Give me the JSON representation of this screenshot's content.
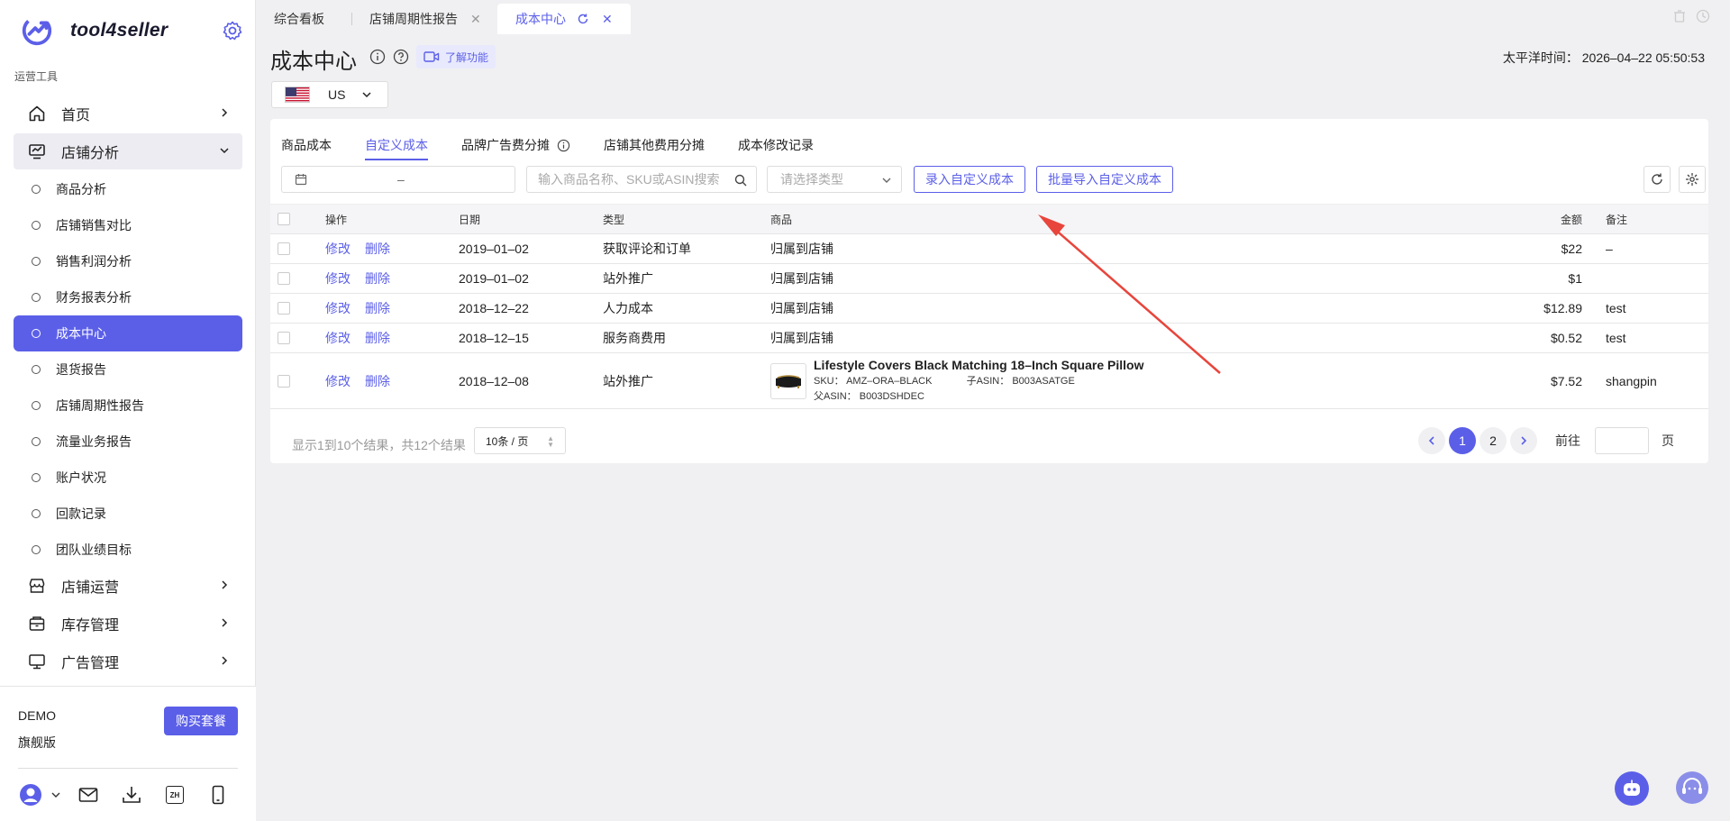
{
  "sidebar": {
    "brand": "tool4seller",
    "section_label": "运营工具",
    "top_items": [
      {
        "label": "首页",
        "icon": "home-icon"
      },
      {
        "label": "店铺分析",
        "icon": "analytics-icon"
      }
    ],
    "sub_items": [
      {
        "label": "商品分析"
      },
      {
        "label": "店铺销售对比"
      },
      {
        "label": "销售利润分析"
      },
      {
        "label": "财务报表分析"
      },
      {
        "label": "成本中心",
        "active": true
      },
      {
        "label": "退货报告"
      },
      {
        "label": "店铺周期性报告"
      },
      {
        "label": "流量业务报告"
      },
      {
        "label": "账户状况"
      },
      {
        "label": "回款记录"
      },
      {
        "label": "团队业绩目标"
      }
    ],
    "bottom_items": [
      {
        "label": "店铺运营",
        "icon": "store-icon"
      },
      {
        "label": "库存管理",
        "icon": "inventory-icon"
      },
      {
        "label": "广告管理",
        "icon": "monitor-icon"
      }
    ],
    "plan_name": "DEMO",
    "plan_tier": "旗舰版",
    "buy_button": "购买套餐",
    "lang_badge": "ZH"
  },
  "tabs": [
    {
      "label": "综合看板"
    },
    {
      "label": "店铺周期性报告"
    },
    {
      "label": "成本中心",
      "active": true
    }
  ],
  "header": {
    "title": "成本中心",
    "learn_button": "了解功能",
    "timezone": "太平洋时间： 2026–04–22 05:50:53",
    "country": "US"
  },
  "subtabs": [
    {
      "label": "商品成本"
    },
    {
      "label": "自定义成本",
      "active": true
    },
    {
      "label": "品牌广告费分摊"
    },
    {
      "label": "店铺其他费用分摊"
    },
    {
      "label": "成本修改记录"
    }
  ],
  "filters": {
    "date_separator": "–",
    "search_placeholder": "输入商品名称、SKU或ASIN搜索",
    "type_placeholder": "请选择类型",
    "add_button": "录入自定义成本",
    "import_button": "批量导入自定义成本"
  },
  "table": {
    "columns": {
      "op": "操作",
      "date": "日期",
      "type": "类型",
      "product": "商品",
      "amount": "金额",
      "note": "备注"
    },
    "edit_label": "修改",
    "delete_label": "删除",
    "rows": [
      {
        "date": "2019–01–02",
        "type": "获取评论和订单",
        "product": "归属到店铺",
        "amount": "$22",
        "note": "–"
      },
      {
        "date": "2019–01–02",
        "type": "站外推广",
        "product": "归属到店铺",
        "amount": "$1",
        "note": ""
      },
      {
        "date": "2018–12–22",
        "type": "人力成本",
        "product": "归属到店铺",
        "amount": "$12.89",
        "note": "test"
      },
      {
        "date": "2018–12–15",
        "type": "服务商费用",
        "product": "归属到店铺",
        "amount": "$0.52",
        "note": "test"
      }
    ],
    "product_row": {
      "date": "2018–12–08",
      "type": "站外推广",
      "title": "Lifestyle Covers Black Matching 18–Inch Square Pillow",
      "sku_label": "SKU：",
      "sku": "AMZ–ORA–BLACK",
      "child_asin_label": "子ASIN：",
      "child_asin": "B003ASATGE",
      "parent_asin_label": "父ASIN：",
      "parent_asin": "B003DSHDEC",
      "amount": "$7.52",
      "note": "shangpin"
    }
  },
  "footer": {
    "summary": "显示1到10个结果，共12个结果",
    "page_size": "10条 / 页",
    "pages": [
      "1",
      "2"
    ],
    "current_page": "1",
    "goto_label": "前往",
    "goto_suffix": "页"
  },
  "colors": {
    "accent": "#5b5fe8",
    "annotation": "#e8453c"
  }
}
